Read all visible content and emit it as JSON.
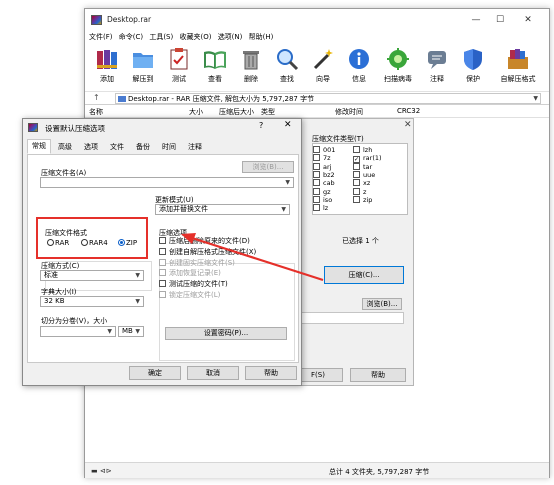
{
  "window": {
    "title": "Desktop.rar",
    "controls": [
      "—",
      "☐",
      "✕"
    ]
  },
  "menu": [
    "文件(F)",
    "命令(C)",
    "工具(S)",
    "收藏夹(O)",
    "选项(N)",
    "帮助(H)"
  ],
  "toolbar": [
    {
      "label": "添加",
      "icon": "books-icon"
    },
    {
      "label": "解压到",
      "icon": "folder-icon"
    },
    {
      "label": "测试",
      "icon": "clipboard-check-icon"
    },
    {
      "label": "查看",
      "icon": "open-book-icon"
    },
    {
      "label": "删除",
      "icon": "trash-icon"
    },
    {
      "label": "查找",
      "icon": "magnifier-icon"
    },
    {
      "label": "向导",
      "icon": "magic-wand-icon"
    },
    {
      "label": "信息",
      "icon": "info-icon"
    },
    {
      "label": "扫描病毒",
      "icon": "virus-scan-icon"
    },
    {
      "label": "注释",
      "icon": "comment-icon"
    },
    {
      "label": "保护",
      "icon": "shield-icon"
    },
    {
      "label": "自解压格式",
      "icon": "sfx-box-icon"
    }
  ],
  "address": {
    "text": "Desktop.rar - RAR 压缩文件, 解包大小为 5,797,287 字节"
  },
  "columns": [
    "名称",
    "大小",
    "压缩后大小",
    "类型",
    "修改时间",
    "CRC32"
  ],
  "status": {
    "text": "总计 4 文件夹, 5,797,287 字节"
  },
  "background_dialog": {
    "group_title": "压缩文件类型(T)",
    "types_col1": [
      "001",
      "7z",
      "arj",
      "bz2",
      "cab",
      "gz",
      "iso",
      "lz"
    ],
    "types_col2": [
      "lzh",
      "rar(1)",
      "tar",
      "uue",
      "xz",
      "z",
      "zip"
    ],
    "checked": "rar(1)",
    "selected_count": "已选择 1 个",
    "compress_button": "压缩(C)...",
    "browse_button": "浏览(B)...",
    "s_button": "F(S)",
    "help_button": "帮助"
  },
  "dialog": {
    "title": "设置默认压缩选项",
    "help_mark": "?",
    "close": "✕",
    "tabs": [
      "常规",
      "高级",
      "选项",
      "文件",
      "备份",
      "时间",
      "注释"
    ],
    "archive_name_label": "压缩文件名(A)",
    "browse_label": "浏览(B)...",
    "update_mode_label": "更新模式(U)",
    "update_mode_value": "添加并替换文件",
    "format_label": "压缩文件格式",
    "format_options": [
      "RAR",
      "RAR4",
      "ZIP"
    ],
    "format_selected": "ZIP",
    "method_label": "压缩方式(C)",
    "method_value": "标准",
    "dict_label": "字典大小(I)",
    "dict_value": "32 KB",
    "split_label": "切分为分卷(V)，大小",
    "split_unit": "MB",
    "options_title": "压缩选项",
    "options": [
      {
        "label": "压缩后删除原来的文件(D)",
        "disabled": false
      },
      {
        "label": "创建自解压格式压缩文件(X)",
        "disabled": false
      },
      {
        "label": "创建固实压缩文件(S)",
        "disabled": true
      },
      {
        "label": "添加恢复记录(E)",
        "disabled": true
      },
      {
        "label": "测试压缩的文件(T)",
        "disabled": false
      },
      {
        "label": "锁定压缩文件(L)",
        "disabled": true
      }
    ],
    "password_button": "设置密码(P)...",
    "ok_button": "确定",
    "cancel_button": "取消",
    "help_button": "帮助"
  },
  "colors": {
    "highlight": "#e5302a",
    "radio_selected": "#0b5fc9",
    "focus_border": "#0078d7"
  }
}
